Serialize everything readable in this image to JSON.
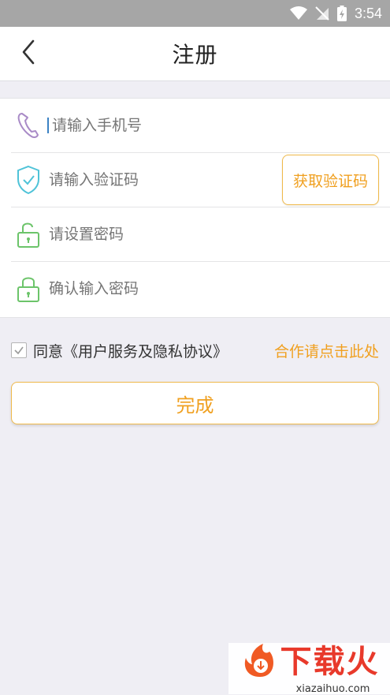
{
  "status_bar": {
    "time": "3:54"
  },
  "nav": {
    "title": "注册"
  },
  "form": {
    "phone_placeholder": "请输入手机号",
    "code_placeholder": "请输入验证码",
    "get_code_label": "获取验证码",
    "password_placeholder": "请设置密码",
    "confirm_placeholder": "确认输入密码"
  },
  "agreement": {
    "text": "同意《用户服务及隐私协议》",
    "checked": true,
    "cooperate_link": "合作请点击此处"
  },
  "submit_label": "完成",
  "watermark": {
    "title": "下载火",
    "url": "xiazaihuo.com"
  },
  "colors": {
    "accent": "#f0a020",
    "phone_icon": "#a98bc7",
    "shield_icon": "#4fc3d8",
    "lock_icon": "#6cc46a"
  }
}
